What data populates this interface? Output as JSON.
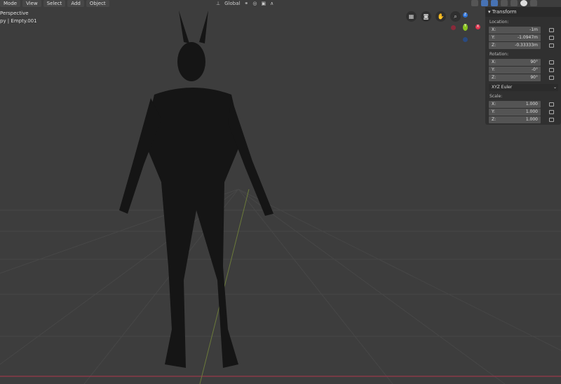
{
  "header": {
    "menus": [
      "Mode",
      "View",
      "Select",
      "Add",
      "Object"
    ],
    "orientation": "Global"
  },
  "overlay": {
    "view": "Perspective",
    "object": "py | Empty.001"
  },
  "transform": {
    "title": "Transform",
    "location_label": "Location:",
    "location": [
      {
        "axis": "X:",
        "value": "-1m"
      },
      {
        "axis": "Y:",
        "value": "-1.0947m"
      },
      {
        "axis": "Z:",
        "value": "-0.33333m"
      }
    ],
    "rotation_label": "Rotation:",
    "rotation": [
      {
        "axis": "X:",
        "value": "90°"
      },
      {
        "axis": "Y:",
        "value": "-0°"
      },
      {
        "axis": "Z:",
        "value": "90°"
      }
    ],
    "rotation_mode": "XYZ Euler",
    "scale_label": "Scale:",
    "scale": [
      {
        "axis": "X:",
        "value": "1.000"
      },
      {
        "axis": "Y:",
        "value": "1.000"
      },
      {
        "axis": "Z:",
        "value": "1.000"
      }
    ]
  },
  "gizmo": {
    "z": "Z",
    "y": "Y",
    "x": "X"
  }
}
